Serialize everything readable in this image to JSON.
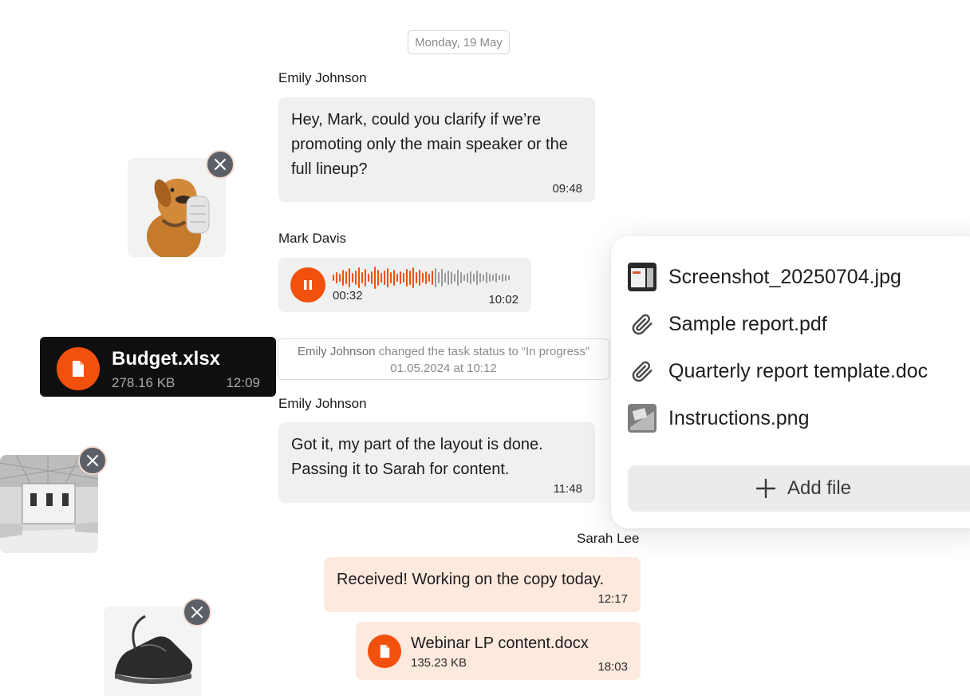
{
  "date_chip": "Monday, 19 May",
  "messages": {
    "m1": {
      "sender": "Emily Johnson",
      "lines": [
        "Hey, Mark, could you clarify if we’re",
        "promoting only the main speaker or the",
        "full lineup?"
      ],
      "time": "09:48"
    },
    "m2": {
      "sender": "Mark Davis",
      "audio_position": "00:32",
      "time": "10:02"
    },
    "m3": {
      "sender": "Emily Johnson",
      "lines": [
        "Got it, my part of the layout is done.",
        "Passing it to Sarah for content."
      ],
      "time": "11:48"
    },
    "m4": {
      "sender": "Sarah Lee",
      "text": "Received! Working on the copy today.",
      "time": "12:17"
    },
    "m5": {
      "file_name": "Webinar LP content.docx",
      "file_size": "135.23 KB",
      "time": "18:03"
    }
  },
  "budget_file": {
    "name": "Budget.xlsx",
    "size": "278.16 KB",
    "time": "12:09"
  },
  "status_note": {
    "actor": "Emily Johnson",
    "action": " changed the task status to “In progress”",
    "date": "01.05.2024 at 10:12"
  },
  "attachments": {
    "items": [
      {
        "name": "Screenshot_20250704.jpg",
        "icon": "image-thumbnail-icon"
      },
      {
        "name": "Sample report.pdf",
        "icon": "paperclip-icon"
      },
      {
        "name": "Quarterly report template.doc",
        "icon": "paperclip-icon"
      },
      {
        "name": "Instructions.png",
        "icon": "image-thumbnail-icon"
      }
    ],
    "add_label": "Add file"
  },
  "colors": {
    "accent": "#f2500d",
    "outgoing_bubble": "#fde9de",
    "incoming_bubble": "#f0f0f0",
    "dark_card": "#0f0f0f"
  }
}
